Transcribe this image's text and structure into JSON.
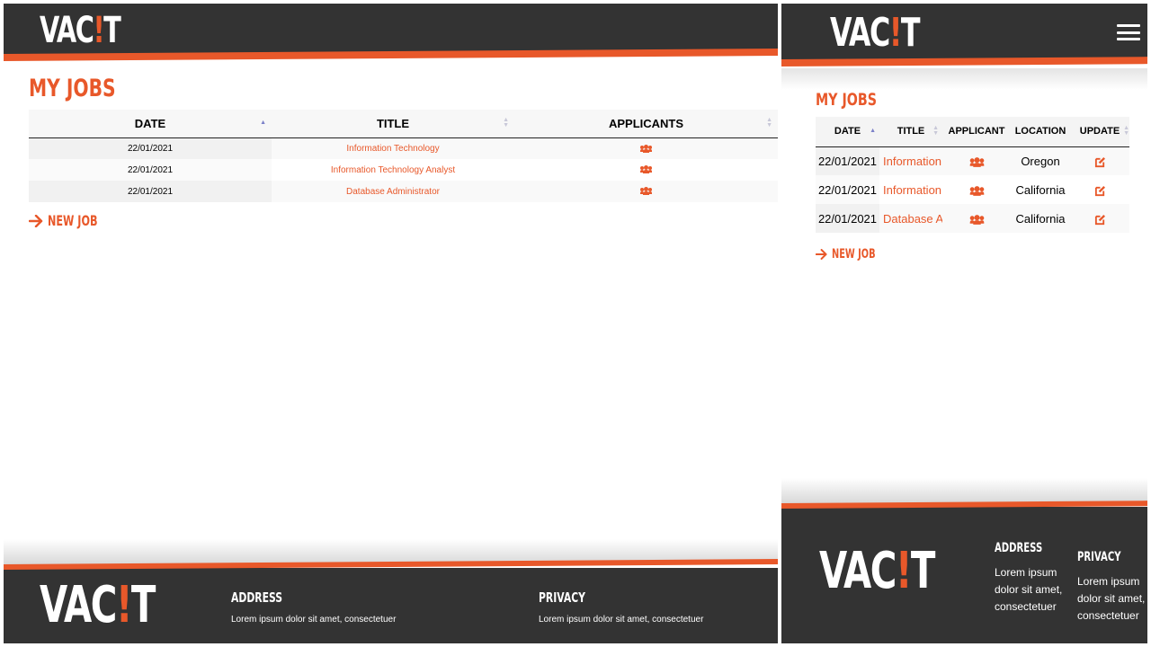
{
  "brand": {
    "logo_prefix": "VAC",
    "logo_bang": "!",
    "logo_suffix": "T"
  },
  "page": {
    "title": "MY JOBS",
    "new_job_label": "NEW JOB"
  },
  "desktop_table": {
    "headers": {
      "date": "DATE",
      "title": "TITLE",
      "applicants": "APPLICANTS"
    },
    "rows": [
      {
        "date": "22/01/2021",
        "title": "Information Technology"
      },
      {
        "date": "22/01/2021",
        "title": "Information Technology Analyst"
      },
      {
        "date": "22/01/2021",
        "title": "Database Administrator"
      }
    ]
  },
  "mobile_table": {
    "headers": {
      "date": "DATE",
      "title": "TITLE",
      "applicants": "APPLICANT",
      "location": "LOCATION",
      "update": "UPDATE"
    },
    "rows": [
      {
        "date": "22/01/2021",
        "title": "Information",
        "location": "Oregon"
      },
      {
        "date": "22/01/2021",
        "title": "Information",
        "location": "California"
      },
      {
        "date": "22/01/2021",
        "title": "Database A",
        "location": "California"
      }
    ]
  },
  "footer": {
    "address_heading": "ADDRESS",
    "address_text": "Lorem ipsum dolor sit amet, consectetuer",
    "privacy_heading": "PRIVACY",
    "privacy_text": "Lorem ipsum dolor sit amet, consectetuer"
  },
  "colors": {
    "accent": "#e8582a",
    "dark": "#333333",
    "sort_active": "#7b80c8"
  },
  "icons": {
    "applicants": "users-icon",
    "update": "edit-icon",
    "new_job": "arrow-right-icon",
    "menu": "hamburger-icon"
  }
}
